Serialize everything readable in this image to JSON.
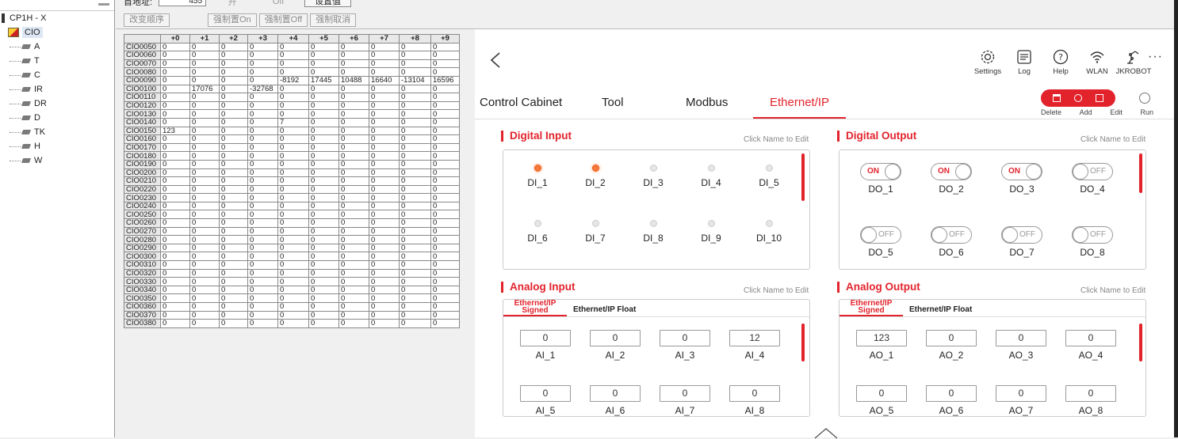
{
  "tree": {
    "root": "CP1H - X",
    "selected": "CIO",
    "children": [
      "A",
      "T",
      "C",
      "IR",
      "DR",
      "D",
      "TK",
      "H",
      "W"
    ]
  },
  "addr": {
    "label_partial": "首地址:",
    "value_partial": "455",
    "on_partial": "开",
    "off_partial": "Off",
    "set_value": "设置值",
    "buttons": [
      "改变顺序",
      "强制置On",
      "强制置Off",
      "强制取消"
    ]
  },
  "memtable": {
    "columns": [
      "+0",
      "+1",
      "+2",
      "+3",
      "+4",
      "+5",
      "+6",
      "+7",
      "+8",
      "+9"
    ],
    "rows": [
      {
        "addr": "CIO0050",
        "v": [
          "0",
          "0",
          "0",
          "0",
          "0",
          "0",
          "0",
          "0",
          "0",
          "0"
        ]
      },
      {
        "addr": "CIO0060",
        "v": [
          "0",
          "0",
          "0",
          "0",
          "0",
          "0",
          "0",
          "0",
          "0",
          "0"
        ]
      },
      {
        "addr": "CIO0070",
        "v": [
          "0",
          "0",
          "0",
          "0",
          "0",
          "0",
          "0",
          "0",
          "0",
          "0"
        ]
      },
      {
        "addr": "CIO0080",
        "v": [
          "0",
          "0",
          "0",
          "0",
          "0",
          "0",
          "0",
          "0",
          "0",
          "0"
        ]
      },
      {
        "addr": "CIO0090",
        "v": [
          "0",
          "0",
          "0",
          "0",
          "-8192",
          "17445",
          "10488",
          "16640",
          "-13104",
          "16596"
        ]
      },
      {
        "addr": "CIO0100",
        "v": [
          "0",
          "17076",
          "0",
          "-32768",
          "0",
          "0",
          "0",
          "0",
          "0",
          "0"
        ]
      },
      {
        "addr": "CIO0110",
        "v": [
          "0",
          "0",
          "0",
          "0",
          "0",
          "0",
          "0",
          "0",
          "0",
          "0"
        ]
      },
      {
        "addr": "CIO0120",
        "v": [
          "0",
          "0",
          "0",
          "0",
          "0",
          "0",
          "0",
          "0",
          "0",
          "0"
        ]
      },
      {
        "addr": "CIO0130",
        "v": [
          "0",
          "0",
          "0",
          "0",
          "0",
          "0",
          "0",
          "0",
          "0",
          "0"
        ]
      },
      {
        "addr": "CIO0140",
        "v": [
          "0",
          "0",
          "0",
          "0",
          "7",
          "0",
          "0",
          "0",
          "0",
          "0"
        ]
      },
      {
        "addr": "CIO0150",
        "v": [
          "123",
          "0",
          "0",
          "0",
          "0",
          "0",
          "0",
          "0",
          "0",
          "0"
        ]
      },
      {
        "addr": "CIO0160",
        "v": [
          "0",
          "0",
          "0",
          "0",
          "0",
          "0",
          "0",
          "0",
          "0",
          "0"
        ]
      },
      {
        "addr": "CIO0170",
        "v": [
          "0",
          "0",
          "0",
          "0",
          "0",
          "0",
          "0",
          "0",
          "0",
          "0"
        ]
      },
      {
        "addr": "CIO0180",
        "v": [
          "0",
          "0",
          "0",
          "0",
          "0",
          "0",
          "0",
          "0",
          "0",
          "0"
        ]
      },
      {
        "addr": "CIO0190",
        "v": [
          "0",
          "0",
          "0",
          "0",
          "0",
          "0",
          "0",
          "0",
          "0",
          "0"
        ]
      },
      {
        "addr": "CIO0200",
        "v": [
          "0",
          "0",
          "0",
          "0",
          "0",
          "0",
          "0",
          "0",
          "0",
          "0"
        ]
      },
      {
        "addr": "CIO0210",
        "v": [
          "0",
          "0",
          "0",
          "0",
          "0",
          "0",
          "0",
          "0",
          "0",
          "0"
        ]
      },
      {
        "addr": "CIO0220",
        "v": [
          "0",
          "0",
          "0",
          "0",
          "0",
          "0",
          "0",
          "0",
          "0",
          "0"
        ]
      },
      {
        "addr": "CIO0230",
        "v": [
          "0",
          "0",
          "0",
          "0",
          "0",
          "0",
          "0",
          "0",
          "0",
          "0"
        ]
      },
      {
        "addr": "CIO0240",
        "v": [
          "0",
          "0",
          "0",
          "0",
          "0",
          "0",
          "0",
          "0",
          "0",
          "0"
        ]
      },
      {
        "addr": "CIO0250",
        "v": [
          "0",
          "0",
          "0",
          "0",
          "0",
          "0",
          "0",
          "0",
          "0",
          "0"
        ]
      },
      {
        "addr": "CIO0260",
        "v": [
          "0",
          "0",
          "0",
          "0",
          "0",
          "0",
          "0",
          "0",
          "0",
          "0"
        ]
      },
      {
        "addr": "CIO0270",
        "v": [
          "0",
          "0",
          "0",
          "0",
          "0",
          "0",
          "0",
          "0",
          "0",
          "0"
        ]
      },
      {
        "addr": "CIO0280",
        "v": [
          "0",
          "0",
          "0",
          "0",
          "0",
          "0",
          "0",
          "0",
          "0",
          "0"
        ]
      },
      {
        "addr": "CIO0290",
        "v": [
          "0",
          "0",
          "0",
          "0",
          "0",
          "0",
          "0",
          "0",
          "0",
          "0"
        ]
      },
      {
        "addr": "CIO0300",
        "v": [
          "0",
          "0",
          "0",
          "0",
          "0",
          "0",
          "0",
          "0",
          "0",
          "0"
        ]
      },
      {
        "addr": "CIO0310",
        "v": [
          "0",
          "0",
          "0",
          "0",
          "0",
          "0",
          "0",
          "0",
          "0",
          "0"
        ]
      },
      {
        "addr": "CIO0320",
        "v": [
          "0",
          "0",
          "0",
          "0",
          "0",
          "0",
          "0",
          "0",
          "0",
          "0"
        ]
      },
      {
        "addr": "CIO0330",
        "v": [
          "0",
          "0",
          "0",
          "0",
          "0",
          "0",
          "0",
          "0",
          "0",
          "0"
        ]
      },
      {
        "addr": "CIO0340",
        "v": [
          "0",
          "0",
          "0",
          "0",
          "0",
          "0",
          "0",
          "0",
          "0",
          "0"
        ]
      },
      {
        "addr": "CIO0350",
        "v": [
          "0",
          "0",
          "0",
          "0",
          "0",
          "0",
          "0",
          "0",
          "0",
          "0"
        ]
      },
      {
        "addr": "CIO0360",
        "v": [
          "0",
          "0",
          "0",
          "0",
          "0",
          "0",
          "0",
          "0",
          "0",
          "0"
        ]
      },
      {
        "addr": "CIO0370",
        "v": [
          "0",
          "0",
          "0",
          "0",
          "0",
          "0",
          "0",
          "0",
          "0",
          "0"
        ]
      },
      {
        "addr": "CIO0380",
        "v": [
          "0",
          "0",
          "0",
          "0",
          "0",
          "0",
          "0",
          "0",
          "0",
          "0"
        ]
      }
    ]
  },
  "panel": {
    "top_icons": [
      {
        "icon": "gear-icon",
        "label": "Settings"
      },
      {
        "icon": "log-icon",
        "label": "Log"
      },
      {
        "icon": "help-icon",
        "label": "Help"
      },
      {
        "icon": "wifi-icon",
        "label": "WLAN"
      },
      {
        "icon": "robot-icon",
        "label": "JKROBOT"
      }
    ],
    "more": "···",
    "tabs": [
      "Control Cabinet",
      "Tool",
      "Modbus",
      "Ethernet/IP"
    ],
    "active_tab": "Ethernet/IP",
    "actions": [
      "Delete",
      "Add",
      "Edit",
      "Run"
    ],
    "accent": "#e2232c",
    "hint": "Click Name to Edit",
    "digital_input": {
      "title": "Digital Input",
      "items": [
        {
          "label": "DI_1",
          "on": true
        },
        {
          "label": "DI_2",
          "on": true
        },
        {
          "label": "DI_3",
          "on": false
        },
        {
          "label": "DI_4",
          "on": false
        },
        {
          "label": "DI_5",
          "on": false
        },
        {
          "label": "DI_6",
          "on": false
        },
        {
          "label": "DI_7",
          "on": false
        },
        {
          "label": "DI_8",
          "on": false
        },
        {
          "label": "DI_9",
          "on": false
        },
        {
          "label": "DI_10",
          "on": false
        }
      ]
    },
    "digital_output": {
      "title": "Digital Output",
      "on_text": "ON",
      "off_text": "OFF",
      "items": [
        {
          "label": "DO_1",
          "on": true
        },
        {
          "label": "DO_2",
          "on": true
        },
        {
          "label": "DO_3",
          "on": true
        },
        {
          "label": "DO_4",
          "on": false
        },
        {
          "label": "DO_5",
          "on": false
        },
        {
          "label": "DO_6",
          "on": false
        },
        {
          "label": "DO_7",
          "on": false
        },
        {
          "label": "DO_8",
          "on": false
        }
      ]
    },
    "analog_input": {
      "title": "Analog Input",
      "subtabs": [
        "Ethernet/IP Signed",
        "Ethernet/IP Float"
      ],
      "items": [
        {
          "label": "AI_1",
          "value": "0"
        },
        {
          "label": "AI_2",
          "value": "0"
        },
        {
          "label": "AI_3",
          "value": "0"
        },
        {
          "label": "AI_4",
          "value": "12"
        },
        {
          "label": "AI_5",
          "value": "0"
        },
        {
          "label": "AI_6",
          "value": "0"
        },
        {
          "label": "AI_7",
          "value": "0"
        },
        {
          "label": "AI_8",
          "value": "0"
        }
      ]
    },
    "analog_output": {
      "title": "Analog Output",
      "subtabs": [
        "Ethernet/IP Signed",
        "Ethernet/IP Float"
      ],
      "items": [
        {
          "label": "AO_1",
          "value": "123"
        },
        {
          "label": "AO_2",
          "value": "0"
        },
        {
          "label": "AO_3",
          "value": "0"
        },
        {
          "label": "AO_4",
          "value": "0"
        },
        {
          "label": "AO_5",
          "value": "0"
        },
        {
          "label": "AO_6",
          "value": "0"
        },
        {
          "label": "AO_7",
          "value": "0"
        },
        {
          "label": "AO_8",
          "value": "0"
        }
      ]
    }
  }
}
